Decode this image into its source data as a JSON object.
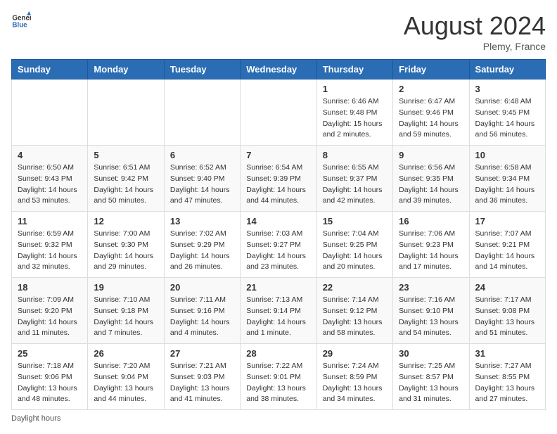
{
  "header": {
    "logo_general": "General",
    "logo_blue": "Blue",
    "month_year": "August 2024",
    "location": "Plemy, France"
  },
  "days_of_week": [
    "Sunday",
    "Monday",
    "Tuesday",
    "Wednesday",
    "Thursday",
    "Friday",
    "Saturday"
  ],
  "weeks": [
    [
      {
        "day": "",
        "info": ""
      },
      {
        "day": "",
        "info": ""
      },
      {
        "day": "",
        "info": ""
      },
      {
        "day": "",
        "info": ""
      },
      {
        "day": "1",
        "info": "Sunrise: 6:46 AM\nSunset: 9:48 PM\nDaylight: 15 hours\nand 2 minutes."
      },
      {
        "day": "2",
        "info": "Sunrise: 6:47 AM\nSunset: 9:46 PM\nDaylight: 14 hours\nand 59 minutes."
      },
      {
        "day": "3",
        "info": "Sunrise: 6:48 AM\nSunset: 9:45 PM\nDaylight: 14 hours\nand 56 minutes."
      }
    ],
    [
      {
        "day": "4",
        "info": "Sunrise: 6:50 AM\nSunset: 9:43 PM\nDaylight: 14 hours\nand 53 minutes."
      },
      {
        "day": "5",
        "info": "Sunrise: 6:51 AM\nSunset: 9:42 PM\nDaylight: 14 hours\nand 50 minutes."
      },
      {
        "day": "6",
        "info": "Sunrise: 6:52 AM\nSunset: 9:40 PM\nDaylight: 14 hours\nand 47 minutes."
      },
      {
        "day": "7",
        "info": "Sunrise: 6:54 AM\nSunset: 9:39 PM\nDaylight: 14 hours\nand 44 minutes."
      },
      {
        "day": "8",
        "info": "Sunrise: 6:55 AM\nSunset: 9:37 PM\nDaylight: 14 hours\nand 42 minutes."
      },
      {
        "day": "9",
        "info": "Sunrise: 6:56 AM\nSunset: 9:35 PM\nDaylight: 14 hours\nand 39 minutes."
      },
      {
        "day": "10",
        "info": "Sunrise: 6:58 AM\nSunset: 9:34 PM\nDaylight: 14 hours\nand 36 minutes."
      }
    ],
    [
      {
        "day": "11",
        "info": "Sunrise: 6:59 AM\nSunset: 9:32 PM\nDaylight: 14 hours\nand 32 minutes."
      },
      {
        "day": "12",
        "info": "Sunrise: 7:00 AM\nSunset: 9:30 PM\nDaylight: 14 hours\nand 29 minutes."
      },
      {
        "day": "13",
        "info": "Sunrise: 7:02 AM\nSunset: 9:29 PM\nDaylight: 14 hours\nand 26 minutes."
      },
      {
        "day": "14",
        "info": "Sunrise: 7:03 AM\nSunset: 9:27 PM\nDaylight: 14 hours\nand 23 minutes."
      },
      {
        "day": "15",
        "info": "Sunrise: 7:04 AM\nSunset: 9:25 PM\nDaylight: 14 hours\nand 20 minutes."
      },
      {
        "day": "16",
        "info": "Sunrise: 7:06 AM\nSunset: 9:23 PM\nDaylight: 14 hours\nand 17 minutes."
      },
      {
        "day": "17",
        "info": "Sunrise: 7:07 AM\nSunset: 9:21 PM\nDaylight: 14 hours\nand 14 minutes."
      }
    ],
    [
      {
        "day": "18",
        "info": "Sunrise: 7:09 AM\nSunset: 9:20 PM\nDaylight: 14 hours\nand 11 minutes."
      },
      {
        "day": "19",
        "info": "Sunrise: 7:10 AM\nSunset: 9:18 PM\nDaylight: 14 hours\nand 7 minutes."
      },
      {
        "day": "20",
        "info": "Sunrise: 7:11 AM\nSunset: 9:16 PM\nDaylight: 14 hours\nand 4 minutes."
      },
      {
        "day": "21",
        "info": "Sunrise: 7:13 AM\nSunset: 9:14 PM\nDaylight: 14 hours\nand 1 minute."
      },
      {
        "day": "22",
        "info": "Sunrise: 7:14 AM\nSunset: 9:12 PM\nDaylight: 13 hours\nand 58 minutes."
      },
      {
        "day": "23",
        "info": "Sunrise: 7:16 AM\nSunset: 9:10 PM\nDaylight: 13 hours\nand 54 minutes."
      },
      {
        "day": "24",
        "info": "Sunrise: 7:17 AM\nSunset: 9:08 PM\nDaylight: 13 hours\nand 51 minutes."
      }
    ],
    [
      {
        "day": "25",
        "info": "Sunrise: 7:18 AM\nSunset: 9:06 PM\nDaylight: 13 hours\nand 48 minutes."
      },
      {
        "day": "26",
        "info": "Sunrise: 7:20 AM\nSunset: 9:04 PM\nDaylight: 13 hours\nand 44 minutes."
      },
      {
        "day": "27",
        "info": "Sunrise: 7:21 AM\nSunset: 9:03 PM\nDaylight: 13 hours\nand 41 minutes."
      },
      {
        "day": "28",
        "info": "Sunrise: 7:22 AM\nSunset: 9:01 PM\nDaylight: 13 hours\nand 38 minutes."
      },
      {
        "day": "29",
        "info": "Sunrise: 7:24 AM\nSunset: 8:59 PM\nDaylight: 13 hours\nand 34 minutes."
      },
      {
        "day": "30",
        "info": "Sunrise: 7:25 AM\nSunset: 8:57 PM\nDaylight: 13 hours\nand 31 minutes."
      },
      {
        "day": "31",
        "info": "Sunrise: 7:27 AM\nSunset: 8:55 PM\nDaylight: 13 hours\nand 27 minutes."
      }
    ]
  ],
  "footer": "Daylight hours"
}
